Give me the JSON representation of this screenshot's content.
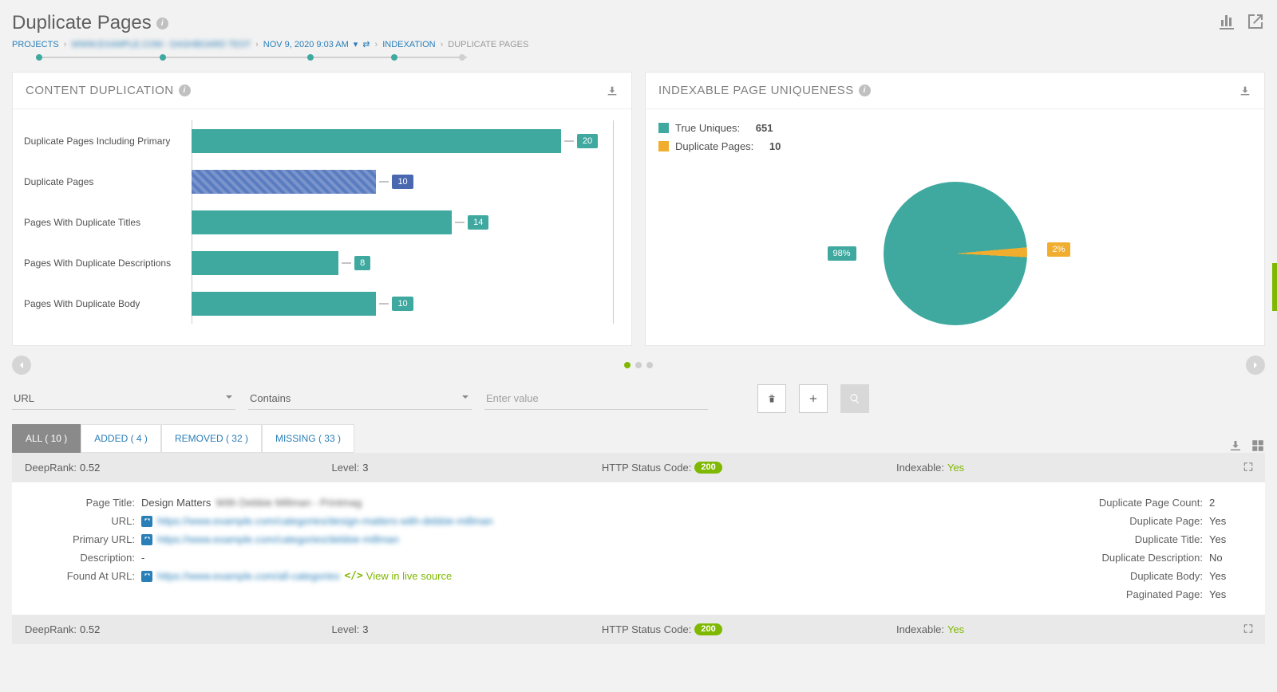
{
  "page_title": "Duplicate Pages",
  "breadcrumb": {
    "projects": "PROJECTS",
    "project_name_blur": "www.example.com - dashboard test",
    "timestamp": "NOV 9, 2020 9:03 AM",
    "indexation": "INDEXATION",
    "current": "DUPLICATE PAGES"
  },
  "card1": {
    "title": "CONTENT DUPLICATION"
  },
  "card2": {
    "title": "INDEXABLE PAGE UNIQUENESS"
  },
  "chart_data": [
    {
      "type": "bar",
      "orientation": "horizontal",
      "categories": [
        "Duplicate Pages Including Primary",
        "Duplicate Pages",
        "Pages With Duplicate Titles",
        "Pages With Duplicate Descriptions",
        "Pages With Duplicate Body"
      ],
      "values": [
        20,
        10,
        14,
        8,
        10
      ],
      "colors": [
        "#3fa9a0",
        "#5a7cc0",
        "#3fa9a0",
        "#3fa9a0",
        "#3fa9a0"
      ],
      "xlim": [
        0,
        20
      ],
      "title": "CONTENT DUPLICATION"
    },
    {
      "type": "pie",
      "title": "INDEXABLE PAGE UNIQUENESS",
      "series": [
        {
          "name": "True Uniques",
          "value": 651,
          "percent": 98,
          "color": "#3fa9a0"
        },
        {
          "name": "Duplicate Pages",
          "value": 10,
          "percent": 2,
          "color": "#f0ad2e"
        }
      ]
    }
  ],
  "legend": {
    "true_uniques_label": "True Uniques:",
    "true_uniques_value": "651",
    "dup_pages_label": "Duplicate Pages:",
    "dup_pages_value": "10"
  },
  "pie_labels": {
    "main": "98%",
    "slice": "2%"
  },
  "filters": {
    "field1": "URL",
    "field2": "Contains",
    "input_placeholder": "Enter value"
  },
  "tabs": {
    "all": "ALL ( 10 )",
    "added": "ADDED ( 4 )",
    "removed": "REMOVED ( 32 )",
    "missing": "MISSING ( 33 )"
  },
  "row1": {
    "deeprank_label": "DeepRank:",
    "deeprank_value": "0.52",
    "level_label": "Level:",
    "level_value": "3",
    "http_label": "HTTP Status Code:",
    "http_value": "200",
    "indexable_label": "Indexable:",
    "indexable_value": "Yes"
  },
  "details": {
    "page_title_lbl": "Page Title:",
    "page_title_val": "Design Matters",
    "page_title_blur": "With Debbie Millman - Printmag",
    "url_lbl": "URL:",
    "url_blur": "https://www.example.com/categories/design-matters-with-debbie-millman",
    "primary_url_lbl": "Primary URL:",
    "primary_url_blur": "https://www.example.com/categories/debbie-millman",
    "description_lbl": "Description:",
    "description_val": "-",
    "found_at_lbl": "Found At URL:",
    "found_at_blur": "https://www.example.com/all-categories",
    "view_src": "View in live source",
    "dup_count_lbl": "Duplicate Page Count:",
    "dup_count_val": "2",
    "dup_page_lbl": "Duplicate Page:",
    "dup_page_val": "Yes",
    "dup_title_lbl": "Duplicate Title:",
    "dup_title_val": "Yes",
    "dup_desc_lbl": "Duplicate Description:",
    "dup_desc_val": "No",
    "dup_body_lbl": "Duplicate Body:",
    "dup_body_val": "Yes",
    "paginated_lbl": "Paginated Page:",
    "paginated_val": "Yes"
  },
  "row2": {
    "deeprank_label": "DeepRank:",
    "deeprank_value": "0.52",
    "level_label": "Level:",
    "level_value": "3",
    "http_label": "HTTP Status Code:",
    "http_value": "200",
    "indexable_label": "Indexable:",
    "indexable_value": "Yes"
  }
}
